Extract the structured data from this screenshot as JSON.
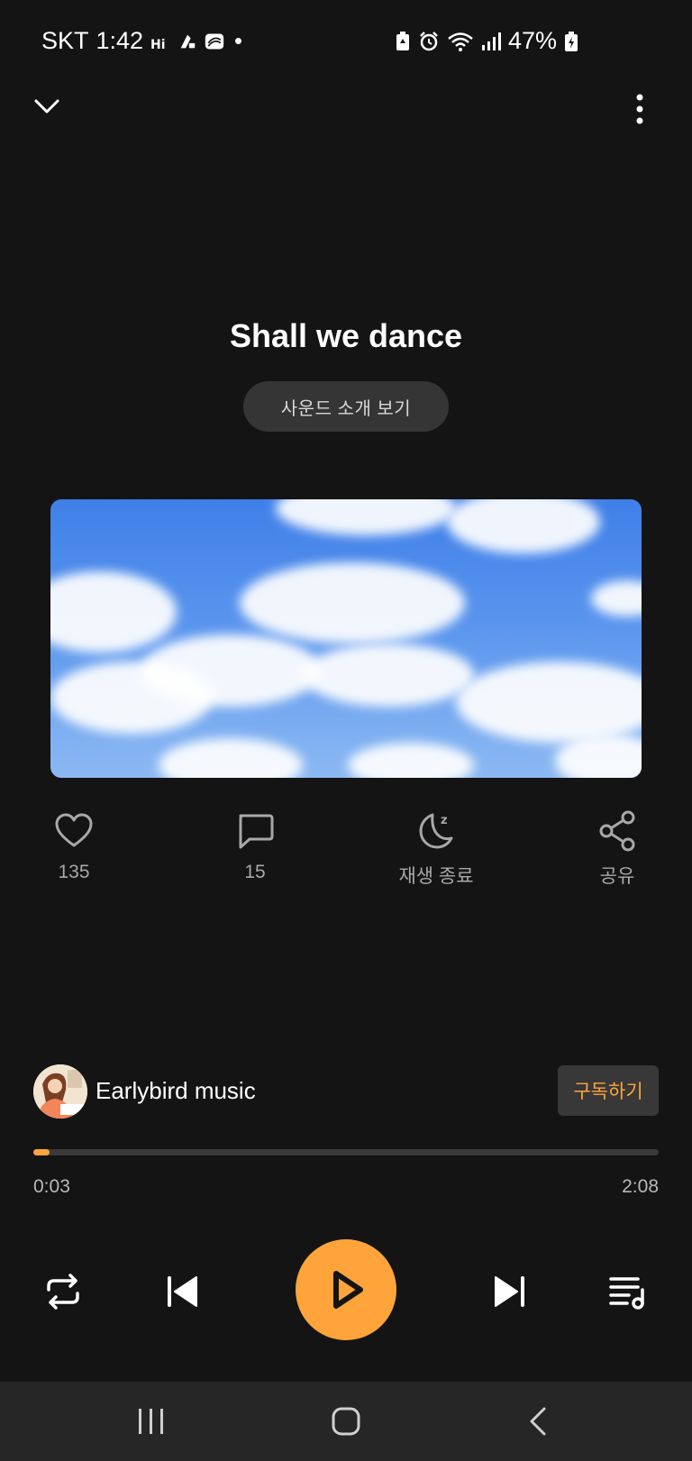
{
  "status_bar": {
    "carrier": "SKT",
    "time": "1:42",
    "battery": "47%",
    "icons": [
      "hd-call-icon",
      "app-notification-icon",
      "app-notification-icon-2",
      "battery-saver-icon",
      "alarm-icon",
      "wifi-icon",
      "signal-icon",
      "battery-charging-icon"
    ]
  },
  "header": {
    "collapse_icon": "chevron-down-icon",
    "more_icon": "more-vertical-icon"
  },
  "track": {
    "title": "Shall we dance",
    "intro_button": "사운드 소개 보기"
  },
  "actions": {
    "like": {
      "icon": "heart-icon",
      "label": "135"
    },
    "comment": {
      "icon": "comment-icon",
      "label": "15"
    },
    "sleep_timer": {
      "icon": "moon-sleep-icon",
      "label": "재생 종료"
    },
    "share": {
      "icon": "share-icon",
      "label": "공유"
    }
  },
  "channel": {
    "name": "Earlybird music",
    "subscribe_button": "구독하기"
  },
  "playback": {
    "elapsed": "0:03",
    "duration": "2:08",
    "progress_fraction": 0.024
  },
  "controls": {
    "repeat_icon": "repeat-icon",
    "previous_icon": "skip-previous-icon",
    "play_icon": "play-icon",
    "next_icon": "skip-next-icon",
    "playlist_icon": "playlist-icon"
  },
  "nav": {
    "recent_icon": "recent-apps-icon",
    "home_icon": "home-icon",
    "back_icon": "back-icon"
  },
  "colors": {
    "background": "#141414",
    "accent": "#ffa43b",
    "surface": "#353535",
    "nav_background": "#262626"
  }
}
